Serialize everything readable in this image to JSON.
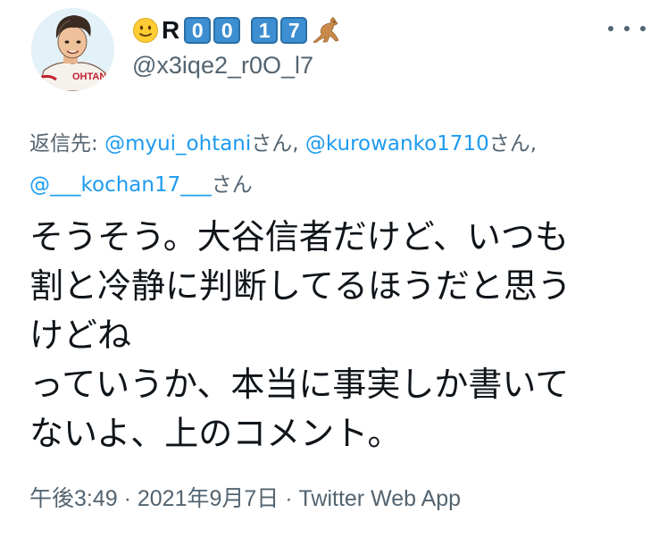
{
  "user": {
    "display_name_letter": "R",
    "display_name_keys": [
      "0",
      "0",
      "1",
      "7"
    ],
    "handle": "@x3iqe2_r0O_l7",
    "avatar_jersey_text": "OHTANI",
    "emoji_prefix": "slightly-smiling-face-icon",
    "emoji_suffix": "kangaroo-icon"
  },
  "reply_to": {
    "prefix": "返信先: ",
    "mentions": [
      "@myui_ohtani",
      "@kurowanko1710",
      "@___kochan17___"
    ],
    "honorific": "さん",
    "separator": ", "
  },
  "tweet": {
    "lines": [
      "そうそう。大谷信者だけど、いつも",
      "割と冷静に判断してるほうだと思う",
      "けどね",
      "っていうか、本当に事実しか書いて",
      "ないよ、上のコメント。"
    ]
  },
  "meta": {
    "text": "午後3:49 · 2021年9月7日 · Twitter Web App"
  },
  "colors": {
    "link": "#1d9bf0",
    "secondary": "#536471",
    "text": "#0f1419",
    "key_blue": "#3d8fd1"
  }
}
